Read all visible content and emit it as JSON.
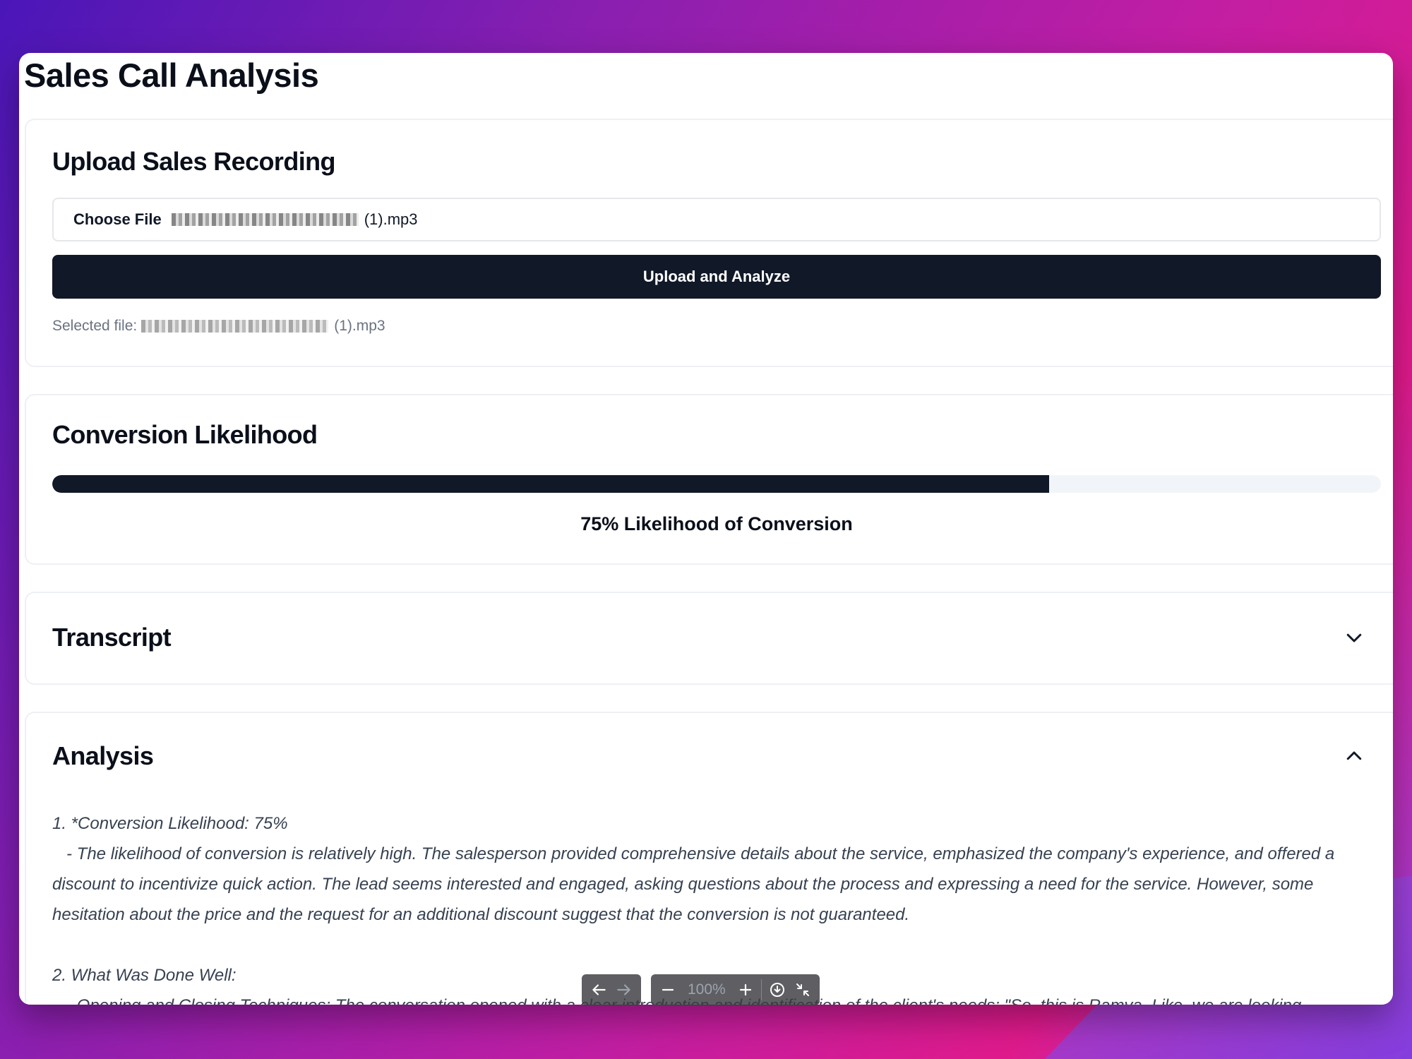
{
  "page": {
    "title": "Sales Call Analysis"
  },
  "upload": {
    "heading": "Upload Sales Recording",
    "choose_label": "Choose File",
    "file_suffix": "(1).mp3",
    "button_label": "Upload and Analyze",
    "selected_label": "Selected file:",
    "selected_suffix": "(1).mp3"
  },
  "conversion": {
    "heading": "Conversion Likelihood",
    "percent": 75,
    "label": "75% Likelihood of Conversion"
  },
  "transcript": {
    "heading": "Transcript",
    "expanded": false
  },
  "analysis": {
    "heading": "Analysis",
    "expanded": true,
    "paragraphs": [
      "1. *Conversion Likelihood: 75%",
      "   - The likelihood of conversion is relatively high. The salesperson provided comprehensive details about the service, emphasized the company's experience, and offered a discount to incentivize quick action. The lead seems interested and engaged, asking questions about the process and expressing a need for the service. However, some hesitation about the price and the request for an additional discount suggest that the conversion is not guaranteed.",
      "2. What Was Done Well:",
      "   - Opening and Closing Techniques: The conversation opened with a clear introduction and identification of the client's needs: \"So, this is Ramya. Like, we are looking"
    ]
  },
  "viewer": {
    "zoom": "100%"
  },
  "colors": {
    "primary": "#111827",
    "track": "#f1f5f9",
    "muted": "#6b7280"
  }
}
